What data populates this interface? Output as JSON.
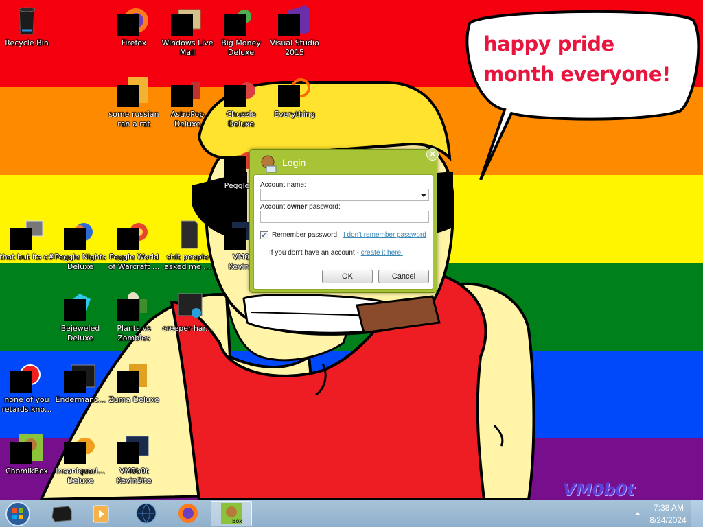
{
  "colors": {
    "stripe_red": "#f4000f",
    "stripe_orange": "#fe8a00",
    "stripe_yellow": "#fff500",
    "stripe_green": "#00801b",
    "stripe_blue": "#0049fb",
    "stripe_purple": "#770e8c",
    "skin": "#fff4a8",
    "hair": "#ffe32e",
    "shirt": "#ee1c23",
    "cigar": "#8a4a2c",
    "bubble_text": "#e8153f",
    "dialog_green": "#a7c437",
    "link": "#3c89b8",
    "taskbar": "#9bbad4"
  },
  "speech_bubble": {
    "text": "happy pride month everyone!"
  },
  "signature": "VM0b0t",
  "desktop_icons": [
    {
      "label": "Recycle Bin",
      "icon": "recycle-bin-icon"
    },
    {
      "label": "Firefox",
      "icon": "firefox-icon"
    },
    {
      "label": "Windows Live\nMail",
      "icon": "mail-icon"
    },
    {
      "label": "Big Money\nDeluxe",
      "icon": "game-icon"
    },
    {
      "label": "Visual Studio\n2015",
      "icon": "visual-studio-icon"
    },
    {
      "label": "some russian\nran a rat",
      "icon": "file-icon"
    },
    {
      "label": "AstroPop\nDeluxe",
      "icon": "game-icon"
    },
    {
      "label": "Chuzzle\nDeluxe",
      "icon": "game-icon"
    },
    {
      "label": "Everything",
      "icon": "search-icon"
    },
    {
      "label": "Peggle D",
      "icon": "game-icon"
    },
    {
      "label": "that but its c#",
      "icon": "folder-icon"
    },
    {
      "label": "Peggle Nights\nDeluxe",
      "icon": "game-icon"
    },
    {
      "label": "Peggle World\nof Warcraft ...",
      "icon": "game-icon"
    },
    {
      "label": "shit people\nasked me ...",
      "icon": "folder-icon"
    },
    {
      "label": "VM0\nKevinS",
      "icon": "shortcut-icon"
    },
    {
      "label": "Bejeweled\nDeluxe",
      "icon": "gem-icon"
    },
    {
      "label": "Plants vs\nZombies",
      "icon": "plant-icon"
    },
    {
      "label": "creeper-har...",
      "icon": "console-icon"
    },
    {
      "label": "none of you\nretards kno...",
      "icon": "game-icon"
    },
    {
      "label": "Endermanc...",
      "icon": "console-icon"
    },
    {
      "label": "Zuma Deluxe",
      "icon": "game-icon"
    },
    {
      "label": "ChomikBox",
      "icon": "chomikbox-icon"
    },
    {
      "label": "Insaniquari...\nDeluxe",
      "icon": "fish-icon"
    },
    {
      "label": "VM0b0t\nKevinSite",
      "icon": "shortcut-icon"
    }
  ],
  "login_dialog": {
    "title": "Login",
    "account_name_label": "Account name:",
    "password_label_prefix": "Account ",
    "password_label_bold": "owner",
    "password_label_suffix": " password:",
    "account_name_value": "",
    "password_value": "",
    "remember_label": "Remember password",
    "remember_checked": true,
    "forgot_link": "I don't remember password",
    "signup_prefix": "If you don't have an account - ",
    "signup_link": "create it here!",
    "ok_label": "OK",
    "cancel_label": "Cancel"
  },
  "taskbar": {
    "items": [
      {
        "name": "start-button",
        "icon": "windows-logo-icon"
      },
      {
        "name": "taskbar-terminal",
        "icon": "terminal-icon"
      },
      {
        "name": "taskbar-media-player",
        "icon": "media-player-icon"
      },
      {
        "name": "taskbar-globe",
        "icon": "globe-icon"
      },
      {
        "name": "taskbar-firefox",
        "icon": "firefox-icon"
      },
      {
        "name": "taskbar-chomikbox",
        "icon": "chomikbox-icon",
        "active": true
      }
    ],
    "clock_time": "7:38 AM",
    "clock_date": "8/24/2024"
  }
}
